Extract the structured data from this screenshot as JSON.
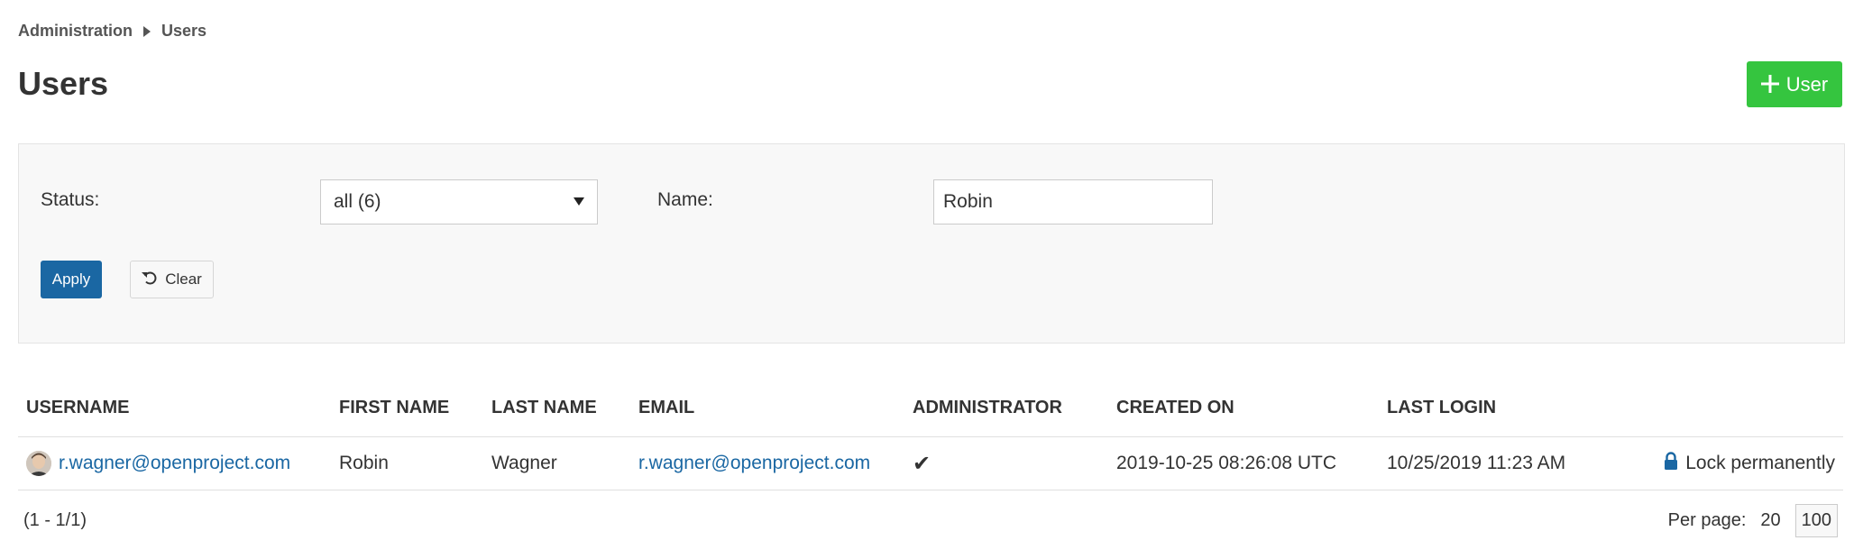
{
  "breadcrumb": {
    "parent": "Administration",
    "current": "Users"
  },
  "page": {
    "title": "Users"
  },
  "toolbar": {
    "add_user_label": "User",
    "add_user_icon": "plus-icon",
    "accent": "#35c53f"
  },
  "filters": {
    "status_label": "Status:",
    "status_value": "all (6)",
    "name_label": "Name:",
    "name_value": "Robin",
    "apply_label": "Apply",
    "clear_label": "Clear",
    "clear_icon": "undo-icon",
    "apply_color": "#1a67a3"
  },
  "table": {
    "columns": [
      "USERNAME",
      "FIRST NAME",
      "LAST NAME",
      "EMAIL",
      "ADMINISTRATOR",
      "CREATED ON",
      "LAST LOGIN"
    ],
    "rows": [
      {
        "username": "r.wagner@openproject.com",
        "first_name": "Robin",
        "last_name": "Wagner",
        "email": "r.wagner@openproject.com",
        "administrator": "✔",
        "created_on": "2019-10-25 08:26:08 UTC",
        "last_login": "10/25/2019 11:23 AM",
        "action_label": "Lock permanently",
        "action_icon": "lock-icon"
      }
    ]
  },
  "pagination": {
    "range": "(1 - 1/1)",
    "per_page_label": "Per page:",
    "options": [
      "20",
      "100"
    ],
    "selected": "100"
  }
}
